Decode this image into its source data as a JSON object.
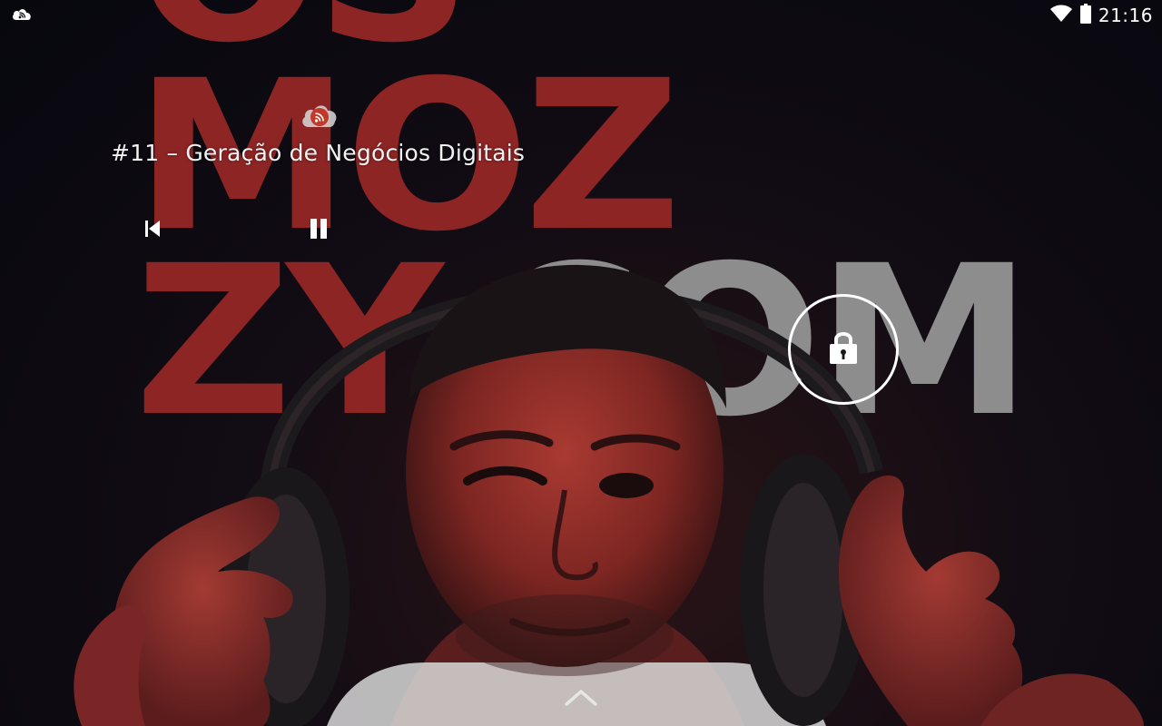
{
  "status_bar": {
    "time": "21:16",
    "left_icon": "podcast-notification-icon",
    "wifi_icon": "wifi-icon",
    "battery_icon": "battery-icon"
  },
  "artwork": {
    "line1": "OS",
    "line2": "MOZ",
    "line3_red": "ZY",
    "line3_grey": ".COM",
    "colors": {
      "red": "#8e2525",
      "grey": "#8d8d8d",
      "background": "#0b0b14"
    }
  },
  "media": {
    "app_icon": "podcast-cloud-icon",
    "title": "#11 – Geração de Negócios Digitais",
    "controls": {
      "previous_icon": "skip-previous-icon",
      "pause_icon": "pause-icon"
    }
  },
  "lock": {
    "icon": "lock-icon"
  },
  "bottom": {
    "icon": "chevron-up-icon"
  }
}
